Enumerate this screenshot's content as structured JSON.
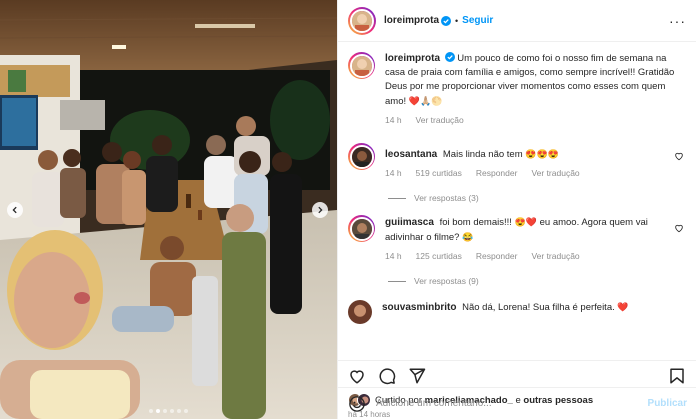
{
  "post": {
    "author": "loreimprota",
    "follow_label": "Seguir",
    "separator": "•",
    "more_label": "···",
    "caption": "Um pouco de como foi o nosso fim de semana na casa de praia com família e amigos, como sempre incrível!! Gratidão Deus por me proporcionar viver momentos como esses com quem amo!",
    "caption_emojis": "❤️🙏🏼🌕",
    "caption_time": "14 h",
    "see_translation": "Ver tradução"
  },
  "comments": [
    {
      "username": "leosantana",
      "text": "Mais linda não tem",
      "emojis": "😍😍😍",
      "time": "14 h",
      "likes": "519 curtidas",
      "reply_label": "Responder",
      "translate_label": "Ver tradução",
      "view_replies": "Ver respostas (3)"
    },
    {
      "username": "guiimasca",
      "text_before": "foi bom demais!!!",
      "emojis_mid": "😍❤️",
      "text_after": "eu amoo. Agora quem vai adivinhar o filme?",
      "emojis_end": "😂",
      "time": "14 h",
      "likes": "125 curtidas",
      "reply_label": "Responder",
      "translate_label": "Ver tradução",
      "view_replies": "Ver respostas (9)"
    },
    {
      "username": "souvasminbrito",
      "text": "Não dá, Lorena! Sua filha é perfeita.",
      "emojis": "❤️"
    }
  ],
  "engagement": {
    "liked_prefix": "Curtido por",
    "liked_user": "mariceliamachado_",
    "liked_joiner": "e",
    "liked_others": "outras pessoas",
    "posted_ago": "há 14 horas"
  },
  "add_comment": {
    "placeholder": "Adicione um comentário...",
    "publish_label": "Publicar"
  },
  "carousel": {
    "slides": 6,
    "active": 1
  },
  "icons": [
    "verified-icon",
    "heart-icon",
    "comment-icon",
    "share-icon",
    "save-icon",
    "emoji-icon",
    "chevron-left-icon",
    "chevron-right-icon"
  ],
  "colors": {
    "accent": "#0095f6",
    "like_red": "#ed4956",
    "muted": "#8e8e8e",
    "publish_disabled": "#b2dffc"
  }
}
